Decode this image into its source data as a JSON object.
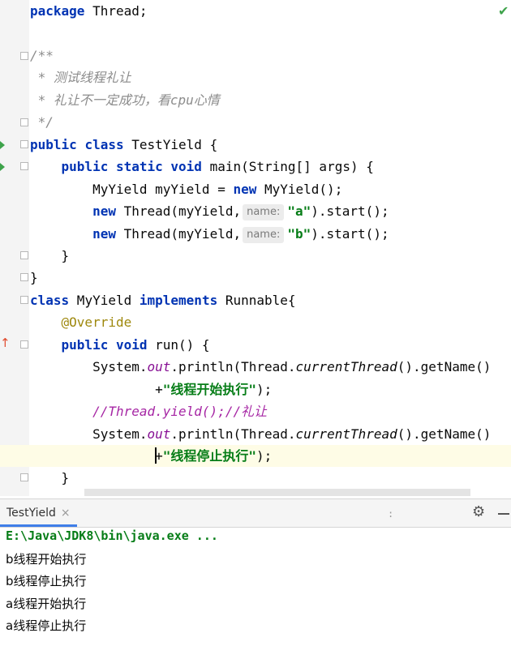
{
  "editor": {
    "lines": {
      "l1": {
        "kw": "package",
        "rest": " Thread;"
      },
      "l3": "/**",
      "l4": " * 测试线程礼让",
      "l5": " * 礼让不一定成功，看cpu心情",
      "l6": " */",
      "l7": {
        "kw1": "public",
        "kw2": "class",
        "rest": " TestYield {"
      },
      "l8": {
        "indent": "    ",
        "kw1": "public",
        "kw2": "static",
        "kw3": "void",
        "rest": " main(String[] args) {"
      },
      "l9": {
        "indent": "        ",
        "a": "MyYield myYield = ",
        "kw": "new",
        "b": " MyYield();"
      },
      "l10": {
        "indent": "        ",
        "kw": "new",
        "a": " Thread(myYield,",
        "hint": "name:",
        "str": "\"a\"",
        "b": ").start();"
      },
      "l11": {
        "indent": "        ",
        "kw": "new",
        "a": " Thread(myYield,",
        "hint": "name:",
        "str": "\"b\"",
        "b": ").start();"
      },
      "l12": "    }",
      "l13": "}",
      "l14": {
        "kw1": "class",
        "a": " MyYield ",
        "kw2": "implements",
        "b": " Runnable{"
      },
      "l15": {
        "indent": "    ",
        "ann": "@Override"
      },
      "l16": {
        "indent": "    ",
        "kw1": "public",
        "kw2": "void",
        "rest": " run() {"
      },
      "l17": {
        "indent": "        ",
        "a": "System.",
        "fld": "out",
        "b": ".println(Thread.",
        "stc": "currentThread",
        "c": "().getName()"
      },
      "l18": {
        "indent": "                ",
        "a": "+",
        "str": "\"线程开始执行\"",
        "b": ");"
      },
      "l19": {
        "indent": "        ",
        "cm": "//Thread.yield();//礼让"
      },
      "l20": {
        "indent": "        ",
        "a": "System.",
        "fld": "out",
        "b": ".println(Thread.",
        "stc": "currentThread",
        "c": "().getName()"
      },
      "l21": {
        "indent": "                ",
        "a": "+",
        "str": "\"线程停止执行\"",
        "b": ");"
      },
      "l22": "    }"
    }
  },
  "console": {
    "tab_label": "TestYield",
    "close_glyph": "×",
    "gear_glyph": "⚙",
    "command": "E:\\Java\\JDK8\\bin\\java.exe ...",
    "output": [
      "b线程开始执行",
      "b线程停止执行",
      "a线程开始执行",
      "a线程停止执行"
    ]
  },
  "icons": {
    "check": "✔",
    "override_arrow": "↑",
    "run": "run-arrow-icon",
    "fold": "fold-marker-icon"
  },
  "colors": {
    "keyword": "#0033b3",
    "string": "#067d17",
    "comment": "#8c8c8c",
    "annotation": "#9e880d",
    "field": "#871094",
    "caret_line": "#fefce6",
    "tab_underline": "#3f7ee8"
  }
}
